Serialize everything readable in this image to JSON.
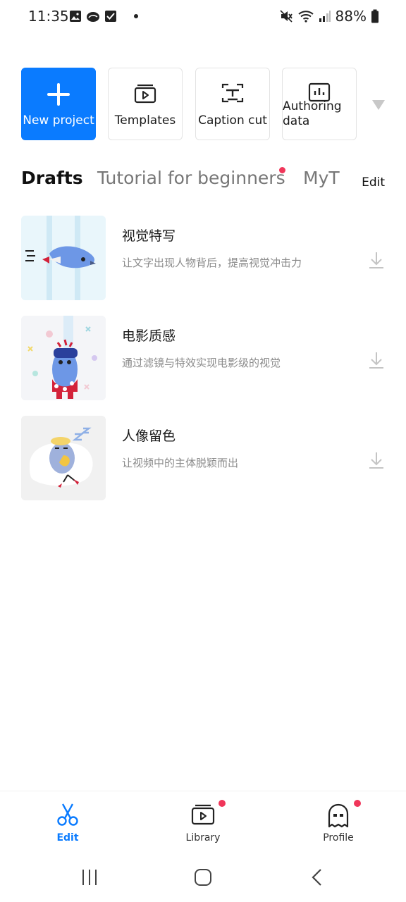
{
  "status_bar": {
    "time": "11:35",
    "battery": "88%",
    "icons": [
      "gallery-icon",
      "cloud-icon",
      "check-icon",
      "dot-icon",
      "mute-icon",
      "wifi-icon",
      "signal-icon",
      "battery-icon"
    ]
  },
  "actions": {
    "new_project": "New project",
    "templates": "Templates",
    "caption_cut": "Caption cut",
    "authoring_line1": "Authoring",
    "authoring_line2": "data"
  },
  "tabs": {
    "drafts": "Drafts",
    "tutorial": "Tutorial for beginners",
    "myt": "MyT",
    "edit": "Edit"
  },
  "items": [
    {
      "title": "视觉特写",
      "desc": "让文字出现人物背后，提高视觉冲击力"
    },
    {
      "title": "电影质感",
      "desc": "通过滤镜与特效实现电影级的视觉"
    },
    {
      "title": "人像留色",
      "desc": "让视频中的主体脱颖而出"
    }
  ],
  "nav": {
    "edit": "Edit",
    "library": "Library",
    "profile": "Profile"
  },
  "colors": {
    "accent": "#0a7bff",
    "badge": "#f0365a"
  }
}
